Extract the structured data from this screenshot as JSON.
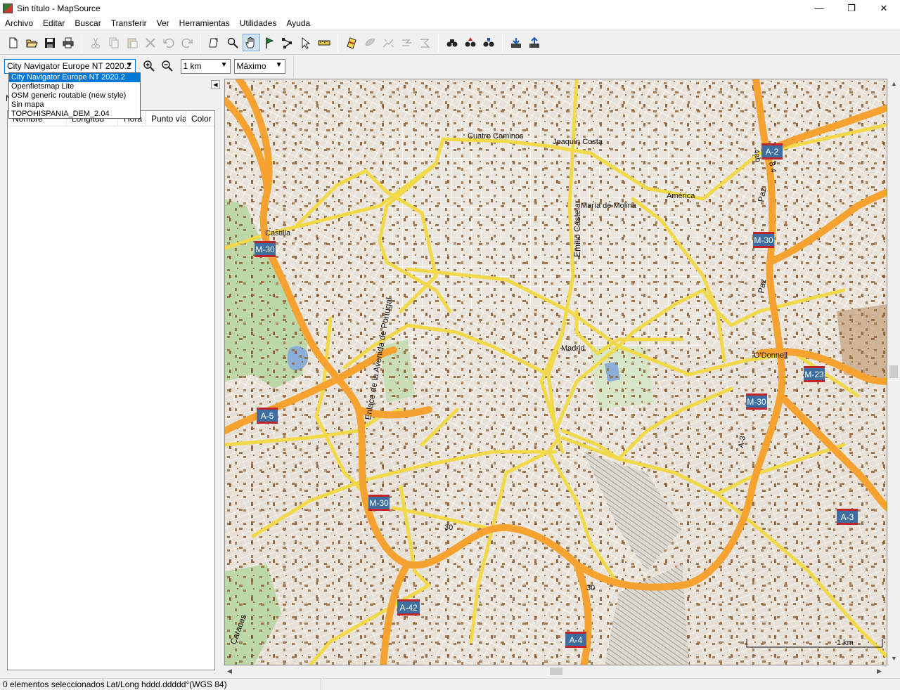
{
  "window": {
    "title": "Sin título - MapSource",
    "controls": {
      "minimize": "—",
      "maximize": "❐",
      "close": "✕"
    }
  },
  "menu": [
    "Archivo",
    "Editar",
    "Buscar",
    "Transferir",
    "Ver",
    "Herramientas",
    "Utilidades",
    "Ayuda"
  ],
  "toolbar": {
    "icons": [
      "new-icon",
      "open-icon",
      "save-icon",
      "print-icon",
      "cut-icon",
      "copy-icon",
      "paste-icon",
      "delete-icon",
      "undo-icon",
      "redo-icon",
      "select-map-tool-icon",
      "zoom-tool-icon",
      "hand-tool-icon",
      "waypoint-tool-icon",
      "route-tool-icon",
      "selection-tool-icon",
      "distance-tool-icon",
      "map-info-icon",
      "tool-a-icon",
      "tool-b-icon",
      "tool-c-icon",
      "tool-d-icon",
      "find-icon",
      "find-places-icon",
      "find-near-icon",
      "receive-device-icon",
      "send-device-icon"
    ]
  },
  "map_controls": {
    "product_selected": "City Navigator Europe NT 2020.2",
    "products": [
      "City Navigator Europe NT 2020.2",
      "Openfietsmap Lite",
      "OSM generic routable (new style)",
      "Sin mapa",
      "TOPOHISPANIA_DEM_2.04"
    ],
    "scale": "1 km",
    "detail": "Máximo"
  },
  "left_panel": {
    "tab_partial": "N",
    "columns": [
      "Nombre",
      "Longitud",
      "Hora",
      "Punto vía",
      "Color"
    ]
  },
  "map": {
    "places": [
      "Cuatro Caminos",
      "Joaquín Costa",
      "María de Molina",
      "América",
      "Castilla",
      "Madrid",
      "O'Donnell"
    ],
    "streets": [
      "Emilio Castelar",
      "Enlace de la Avenida de Portugal",
      "Paz",
      "Paz",
      "Caracas"
    ],
    "shields": [
      "M-30",
      "M-30",
      "M-30",
      "M-30",
      "M-30",
      "A-2",
      "M-23",
      "A-5",
      "A-3",
      "A-42",
      "A-4"
    ],
    "road_numbers": [
      "30",
      "30",
      "A-3"
    ],
    "road_labels": [
      "4ab",
      "8 4"
    ],
    "scale_bar": "1 km",
    "colors": {
      "background": "#e9e4dc",
      "motorway": "#f5a230",
      "primary": "#f2d94a",
      "street": "#ffffff",
      "park": "#bcd8a9",
      "water": "#8aaed8",
      "building": "#9b6b3e",
      "shield_blue": "#3c6fa0",
      "shield_red": "#c0242a"
    }
  },
  "status": {
    "selection": "0 elementos seleccionados",
    "coords_format": "Lat/Long hddd.ddddd°(WGS 84)"
  }
}
